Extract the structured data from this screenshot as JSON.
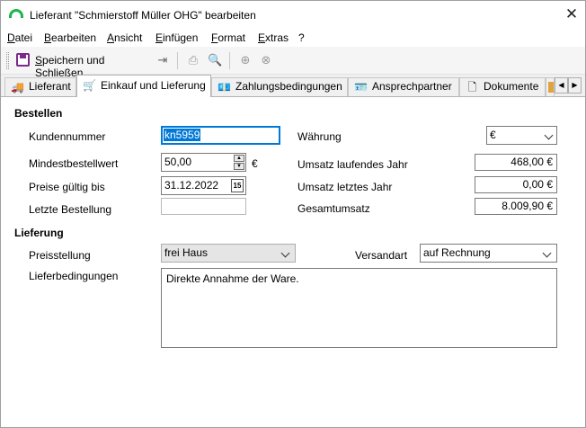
{
  "window": {
    "title": "Lieferant \"Schmierstoff Müller OHG\" bearbeiten",
    "close_icon_glyph": "✕"
  },
  "menu": [
    {
      "underline": "D",
      "rest": "atei"
    },
    {
      "underline": "B",
      "rest": "earbeiten"
    },
    {
      "underline": "A",
      "rest": "nsicht"
    },
    {
      "underline": "E",
      "rest": "infügen"
    },
    {
      "underline": "F",
      "rest": "ormat"
    },
    {
      "underline": "E",
      "rest": "xtras"
    },
    {
      "underline": "",
      "rest": "?"
    }
  ],
  "toolbar": {
    "save_close_label_u": "S",
    "save_close_label_rest": "peichern und Schließen",
    "icons": [
      "save-icon",
      "export-icon",
      "print-icon",
      "print-preview-icon",
      "new-record-icon",
      "delete-record-icon"
    ]
  },
  "tabs": [
    {
      "label": "Lieferant",
      "icon": "truck-icon",
      "glyph": "🚚"
    },
    {
      "label": "Einkauf und Lieferung",
      "icon": "cart-icon",
      "glyph": "🛒"
    },
    {
      "label": "Zahlungsbedingungen",
      "icon": "money-icon",
      "glyph": "💶"
    },
    {
      "label": "Ansprechpartner",
      "icon": "contact-card-icon",
      "glyph": "🪪"
    },
    {
      "label": "Dokumente",
      "icon": "document-icon",
      "glyph": "🗋"
    },
    {
      "label": "",
      "icon": "folder-icon",
      "glyph": ""
    }
  ],
  "active_tab": 1,
  "bestellen": {
    "section_title": "Bestellen",
    "kundennummer_label": "Kundennummer",
    "kundennummer_value": "kn5959",
    "mindestbestellwert_label": "Mindestbestellwert",
    "mindestbestellwert_value": "50,00",
    "mindestbestellwert_unit": "€",
    "preise_label": "Preise gültig bis",
    "preise_value": "31.12.2022",
    "calendar_glyph": "15",
    "letzte_label": "Letzte Bestellung",
    "letzte_value": "",
    "waehrung_label": "Währung",
    "waehrung_value": "€",
    "umsatz_lj_label": "Umsatz laufendes Jahr",
    "umsatz_lj_value": "468,00 €",
    "umsatz_vj_label": "Umsatz letztes Jahr",
    "umsatz_vj_value": "0,00 €",
    "gesamt_label": "Gesamtumsatz",
    "gesamt_value": "8.009,90 €"
  },
  "lieferung": {
    "section_title": "Lieferung",
    "preisstellung_label": "Preisstellung",
    "preisstellung_value": "frei Haus",
    "versandart_label": "Versandart",
    "versandart_value": "auf Rechnung",
    "lieferbedingungen_label": "Lieferbedingungen",
    "lieferbedingungen_value": "Direkte Annahme der Ware."
  },
  "tab_scroll": {
    "left": "◀",
    "right": "▶"
  },
  "colors": {
    "focus": "#0078d7",
    "save_icon": "#7a2a8a",
    "app_icon": "#1db54a"
  }
}
